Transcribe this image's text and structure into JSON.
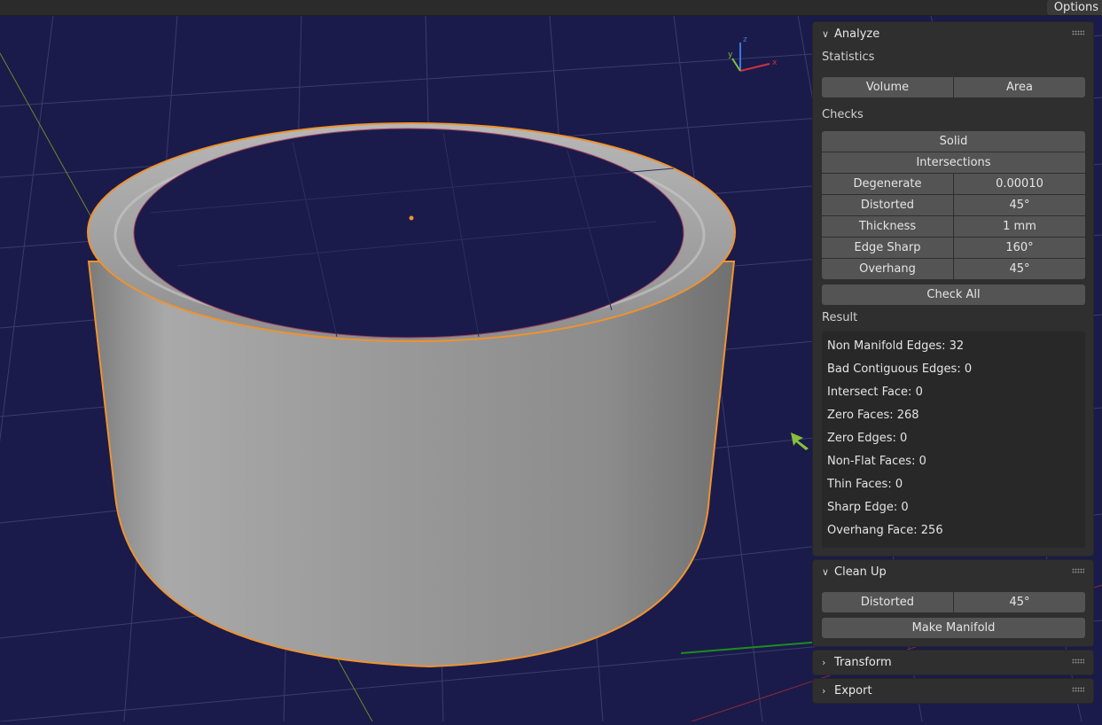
{
  "topbar": {
    "options_label": "Options"
  },
  "gizmo": {
    "z": "z",
    "y": "y",
    "x": "x"
  },
  "analyze": {
    "title": "Analyze",
    "statistics_label": "Statistics",
    "volume_label": "Volume",
    "area_label": "Area",
    "checks_label": "Checks",
    "solid_label": "Solid",
    "intersections_label": "Intersections",
    "checks": [
      {
        "label": "Degenerate",
        "value": "0.00010"
      },
      {
        "label": "Distorted",
        "value": "45°"
      },
      {
        "label": "Thickness",
        "value": "1 mm"
      },
      {
        "label": "Edge Sharp",
        "value": "160°"
      },
      {
        "label": "Overhang",
        "value": "45°"
      }
    ],
    "check_all_label": "Check All",
    "result_label": "Result",
    "results": [
      "Non Manifold Edges: 32",
      "Bad Contiguous Edges: 0",
      "Intersect Face: 0",
      "Zero Faces: 268",
      "Zero Edges: 0",
      "Non-Flat Faces: 0",
      "Thin Faces: 0",
      "Sharp Edge: 0",
      "Overhang Face: 256"
    ]
  },
  "cleanup": {
    "title": "Clean Up",
    "distorted_label": "Distorted",
    "distorted_value": "45°",
    "make_manifold_label": "Make Manifold"
  },
  "transform": {
    "title": "Transform"
  },
  "export": {
    "title": "Export"
  },
  "colors": {
    "viewport_bg": "#1a1b4a",
    "grid": "#3a3c6a",
    "selection_outline": "#f0922e",
    "annotation_arrow": "#1e8c1e",
    "panel_bg": "#2f2f2f",
    "button_bg": "#545454"
  }
}
